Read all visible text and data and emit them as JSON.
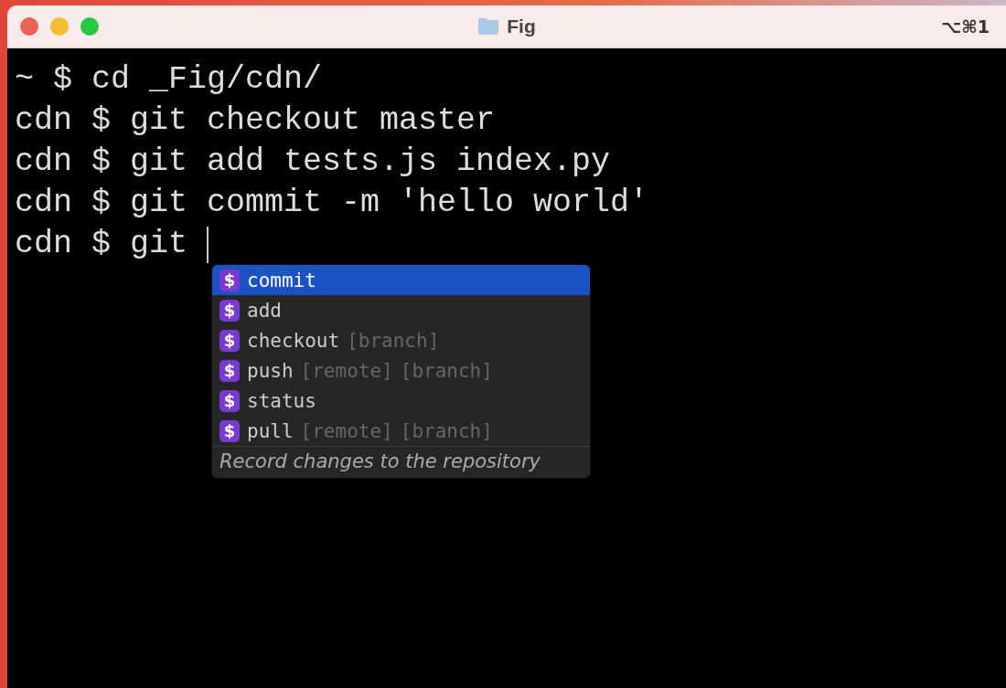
{
  "window": {
    "title": "Fig",
    "shortcut": "⌥⌘1"
  },
  "terminal": {
    "lines": [
      {
        "prompt": "~ $",
        "command": "cd _Fig/cdn/"
      },
      {
        "prompt": "cdn $",
        "command": "git checkout master"
      },
      {
        "prompt": "cdn $",
        "command": "git add tests.js index.py"
      },
      {
        "prompt": "cdn $",
        "command": "git commit -m 'hello world'"
      },
      {
        "prompt": "cdn $",
        "command": "git"
      }
    ]
  },
  "autocomplete": {
    "items": [
      {
        "icon": "$",
        "name": "commit",
        "selected": true
      },
      {
        "icon": "$",
        "name": "add",
        "selected": false
      },
      {
        "icon": "$",
        "name": "checkout",
        "args": [
          "[branch]"
        ],
        "selected": false
      },
      {
        "icon": "$",
        "name": "push",
        "args": [
          "[remote]",
          "[branch]"
        ],
        "selected": false
      },
      {
        "icon": "$",
        "name": "status",
        "selected": false
      },
      {
        "icon": "$",
        "name": "pull",
        "args": [
          "[remote]",
          "[branch]"
        ],
        "selected": false
      }
    ],
    "description": "Record changes to the repository"
  }
}
